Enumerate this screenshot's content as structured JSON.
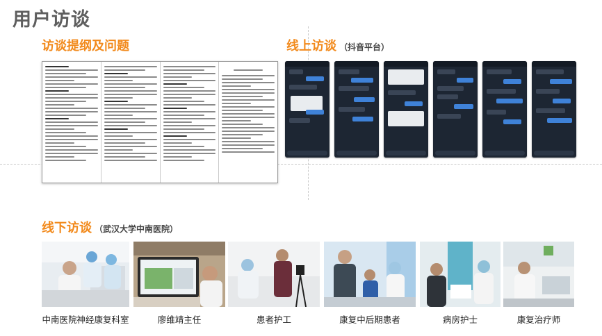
{
  "page": {
    "title": "用户访谈",
    "colors": {
      "accent": "#f28a1c",
      "title": "#5e5e5e"
    }
  },
  "sections": {
    "outline": {
      "title": "访谈提纲及问题"
    },
    "online": {
      "title": "线上访谈",
      "subtitle": "（抖音平台）"
    },
    "offline": {
      "title": "线下访谈",
      "subtitle": "（武汉大学中南医院）"
    }
  },
  "photos": [
    {
      "caption": "中南医院神经康复科室"
    },
    {
      "caption": "廖维靖主任"
    },
    {
      "caption": "患者护工"
    },
    {
      "caption": "康复中后期患者"
    },
    {
      "caption": "病房护士"
    },
    {
      "caption": "康复治疗师"
    }
  ]
}
